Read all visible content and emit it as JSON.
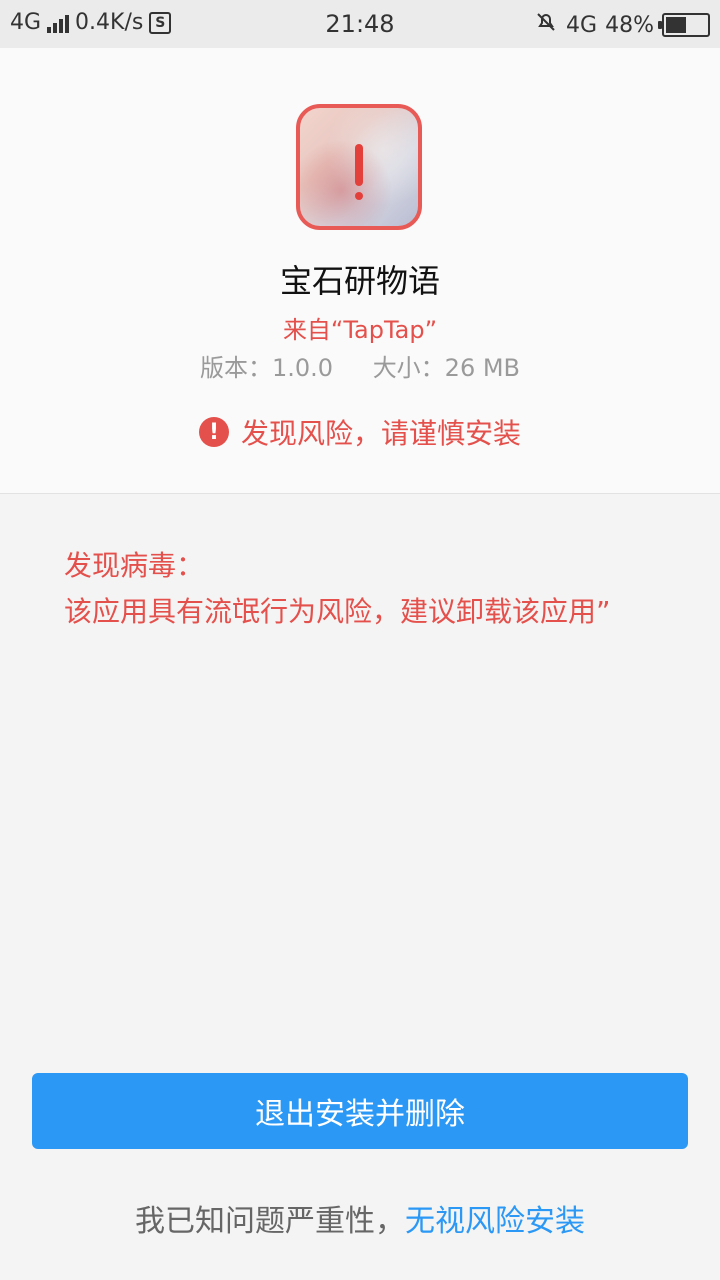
{
  "status_bar": {
    "network": "4G",
    "speed": "0.4K/s",
    "s_icon": "S",
    "time": "21:48",
    "network_right": "4G",
    "battery": "48%"
  },
  "app": {
    "name": "宝石研物语",
    "source": "来自“TapTap”",
    "version": "版本：1.0.0",
    "size": "大小：26 MB",
    "risk_text": "发现风险，请谨慎安装",
    "risk_icon": "!"
  },
  "virus": {
    "title": "发现病毒：",
    "description": "该应用具有流氓行为风险，建议卸载该应用”"
  },
  "actions": {
    "primary_label": "退出安装并删除",
    "footer_prefix": "我已知问题严重性，",
    "footer_link": "无视风险安装"
  },
  "colors": {
    "accent": "#2b98f5",
    "warning": "#e4504b"
  }
}
